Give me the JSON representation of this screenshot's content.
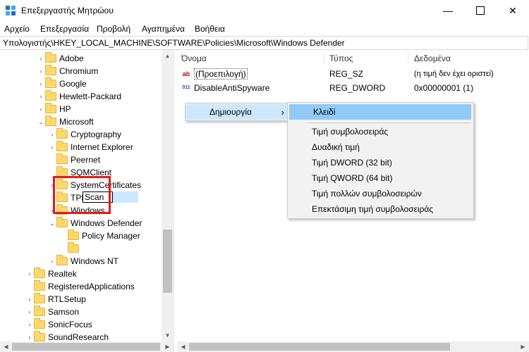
{
  "window": {
    "title": "Επεξεργαστής Μητρώου"
  },
  "menu": [
    "Αρχείο",
    "Επεξεργασία",
    "Προβολή",
    "Αγαπημένα",
    "Βοήθεια"
  ],
  "address": "Υπολογιστής\\HKEY_LOCAL_MACHINE\\SOFTWARE\\Policies\\Microsoft\\Windows Defender",
  "tree": [
    {
      "label": "Adobe",
      "chev": "›"
    },
    {
      "label": "Chromium",
      "chev": "›"
    },
    {
      "label": "Google",
      "chev": "›"
    },
    {
      "label": "Hewlett-Packard",
      "chev": "›"
    },
    {
      "label": "HP",
      "chev": "›"
    },
    {
      "label": "Microsoft",
      "chev": "⌄"
    },
    {
      "label": "Cryptography",
      "chev": "›"
    },
    {
      "label": "Internet Explorer",
      "chev": "›"
    },
    {
      "label": "Peernet",
      "chev": ""
    },
    {
      "label": "SQMClient",
      "chev": ""
    },
    {
      "label": "SystemCertificates",
      "chev": "›"
    },
    {
      "label": "TPM",
      "chev": ""
    },
    {
      "label": "Windows",
      "chev": "›"
    },
    {
      "label": "Windows Defender",
      "chev": "⌄"
    },
    {
      "label": "Policy Manager",
      "chev": ""
    },
    {
      "label": "Scan",
      "chev": ""
    },
    {
      "label": "Windows NT",
      "chev": "›"
    },
    {
      "label": "Realtek",
      "chev": "›"
    },
    {
      "label": "RegisteredApplications",
      "chev": ""
    },
    {
      "label": "RTLSetup",
      "chev": "›"
    },
    {
      "label": "Samson",
      "chev": "›"
    },
    {
      "label": "SonicFocus",
      "chev": "›"
    },
    {
      "label": "SoundResearch",
      "chev": "›"
    }
  ],
  "columns": {
    "name": "Όνομα",
    "type": "Τύπος",
    "data": "Δεδομένα"
  },
  "values": [
    {
      "name": "(Προεπιλογή)",
      "type": "REG_SZ",
      "data": "(η τιμή δεν έχει οριστεί)",
      "icon": "ab"
    },
    {
      "name": "DisableAntiSpyware",
      "type": "REG_DWORD",
      "data": "0x00000001 (1)",
      "icon": "011"
    }
  ],
  "context_menu": {
    "label": "Δημιουργία",
    "arrow": "›"
  },
  "submenu": [
    "Κλειδί",
    "Τιμή συμβολοσειράς",
    "Δυαδική τιμή",
    "Τιμή DWORD (32 bit)",
    "Τιμή QWORD (64 bit)",
    "Τιμή πολλών συμβολοσειρών",
    "Επεκτάσιμη τιμή συμβολοσειράς"
  ],
  "rename_value": "Scan"
}
